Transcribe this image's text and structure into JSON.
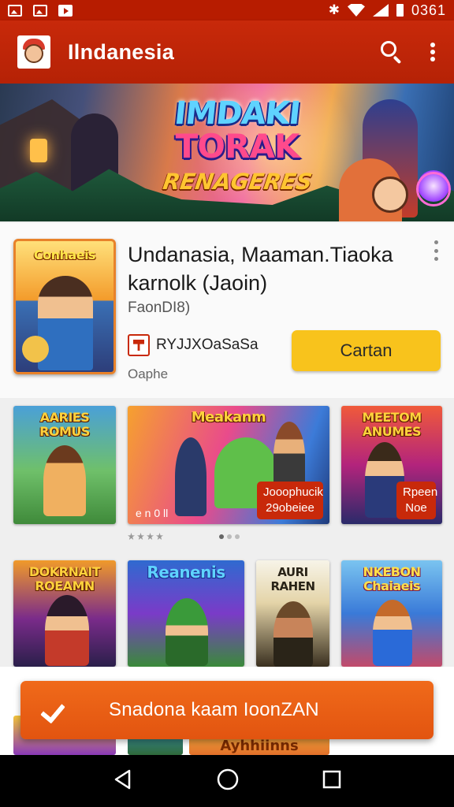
{
  "status_bar": {
    "time": "0361",
    "icons": [
      "gallery-icon",
      "image-icon",
      "play-store-icon",
      "bluetooth-icon",
      "wifi-icon",
      "signal-icon",
      "battery-icon"
    ]
  },
  "app_bar": {
    "title": "Ilndanesia",
    "logo_icon": "app-logo-icon",
    "actions": [
      "search-icon",
      "more-vert-icon"
    ]
  },
  "hero": {
    "line1": "IMDAKI",
    "line2": "TORAK",
    "line3": "RENAGERES"
  },
  "featured": {
    "cover_title": "Conhaeis",
    "title": "Undanasia, Maaman.Tiaoka karnolk (Jaoin)",
    "subtitle": "FaonDI8)",
    "developer": "RYJJXOaSaSa",
    "meta": "Oaphe",
    "button_label": "Cartan"
  },
  "grid": {
    "tiles": [
      {
        "title": "AARIES ROMUS",
        "badge": "",
        "corner": ""
      },
      {
        "title": "Meakanm",
        "badge": "Jooophucik 29obeiee",
        "corner": "e n 0 ll"
      },
      {
        "title": "MEETOM ANUMES",
        "badge": "Rpeen Noe",
        "corner": ""
      },
      {
        "title": "DOKRNAIT ROEAMN",
        "badge": "",
        "corner": ""
      },
      {
        "title": "Reanenis",
        "badge": "",
        "corner": ""
      },
      {
        "title": "AURI RAHEN",
        "badge": "",
        "corner": ""
      },
      {
        "title": "NKEBON Chaiaeis",
        "badge": "",
        "corner": ""
      }
    ]
  },
  "bottom": {
    "peek_title": "Ayhhiinns",
    "snackbar_text": "Snadona kaam IoonZAN"
  },
  "colors": {
    "primary": "#c8290a",
    "accent": "#f8c31c",
    "snackbar": "#e85a14"
  }
}
